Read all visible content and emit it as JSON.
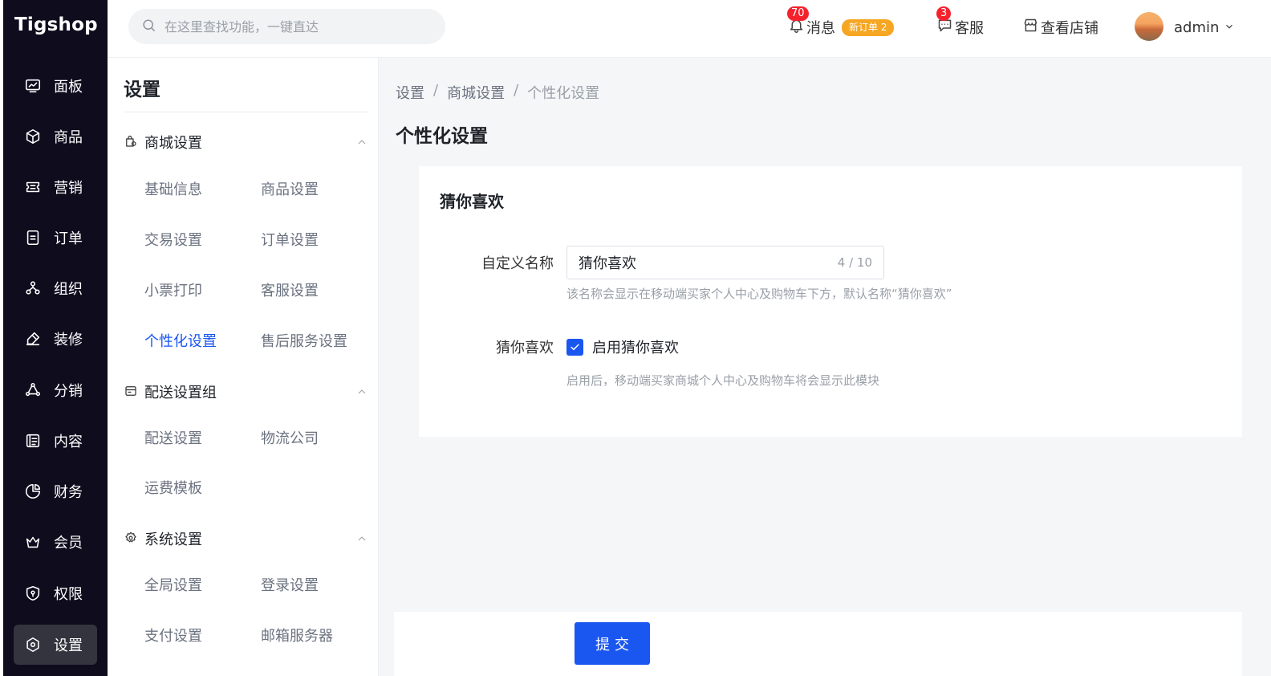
{
  "logo": "Tigshop",
  "nav": [
    {
      "label": "面板",
      "icon": "dashboard-icon"
    },
    {
      "label": "商品",
      "icon": "box-icon"
    },
    {
      "label": "营销",
      "icon": "ticket-icon"
    },
    {
      "label": "订单",
      "icon": "order-icon"
    },
    {
      "label": "组织",
      "icon": "org-icon"
    },
    {
      "label": "装修",
      "icon": "brush-icon"
    },
    {
      "label": "分销",
      "icon": "distribution-icon"
    },
    {
      "label": "内容",
      "icon": "content-icon"
    },
    {
      "label": "财务",
      "icon": "pie-icon"
    },
    {
      "label": "会员",
      "icon": "crown-icon"
    },
    {
      "label": "权限",
      "icon": "shield-icon"
    },
    {
      "label": "设置",
      "icon": "settings-icon",
      "active": true
    }
  ],
  "header": {
    "search_placeholder": "在这里查找功能，一键直达",
    "messages_label": "消息",
    "messages_count": "70",
    "new_order_badge": "新订单 2",
    "service_label": "客服",
    "service_count": "3",
    "view_store_label": "查看店铺",
    "user_name": "admin"
  },
  "submenu": {
    "title": "设置",
    "groups": [
      {
        "label": "商城设置",
        "items": [
          "基础信息",
          "商品设置",
          "交易设置",
          "订单设置",
          "小票打印",
          "客服设置",
          "个性化设置",
          "售后服务设置"
        ]
      },
      {
        "label": "配送设置组",
        "items": [
          "配送设置",
          "物流公司",
          "运费模板"
        ]
      },
      {
        "label": "系统设置",
        "items": [
          "全局设置",
          "登录设置",
          "支付设置",
          "邮箱服务器"
        ]
      }
    ],
    "active_item": "个性化设置"
  },
  "main": {
    "breadcrumb": [
      "设置",
      "商城设置",
      "个性化设置"
    ],
    "page_title": "个性化设置",
    "card_title": "猜你喜欢",
    "custom_name_label": "自定义名称",
    "custom_name_value": "猜你喜欢",
    "custom_name_count": "4 / 10",
    "custom_name_hint": "该名称会显示在移动端买家个人中心及购物车下方，默认名称“猜你喜欢”",
    "toggle_label": "猜你喜欢",
    "toggle_checkbox_label": "启用猜你喜欢",
    "toggle_checked": true,
    "toggle_hint": "启用后，移动端买家商城个人中心及购物车将会显示此模块",
    "submit_label": "提交"
  }
}
